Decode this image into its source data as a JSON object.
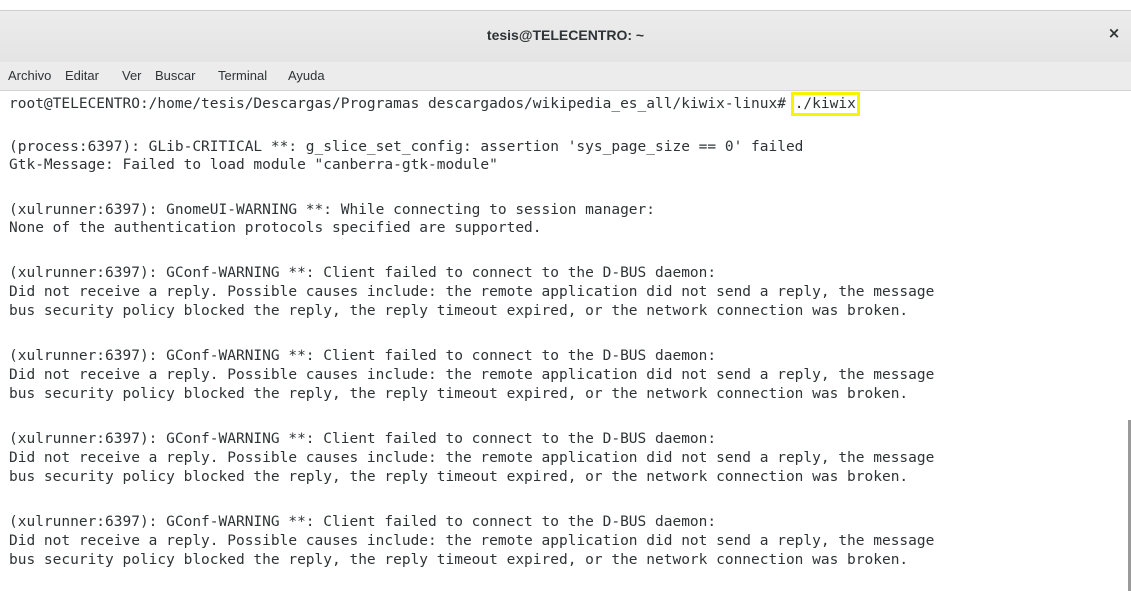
{
  "window": {
    "title": "tesis@TELECENTRO: ~",
    "close_glyph": "×"
  },
  "menu": {
    "items": [
      "Archivo",
      "Editar",
      "Ver",
      "Buscar",
      "Terminal",
      "Ayuda"
    ]
  },
  "terminal": {
    "prompt": "root@TELECENTRO:/home/tesis/Descargas/Programas descargados/wikipedia_es_all/kiwix-linux# ",
    "command": "./kiwix",
    "highlight_color": "#f5f500",
    "output": [
      "(process:6397): GLib-CRITICAL **: g_slice_set_config: assertion 'sys_page_size == 0' failed",
      "Gtk-Message: Failed to load module \"canberra-gtk-module\"",
      "(xulrunner:6397): GnomeUI-WARNING **: While connecting to session manager:",
      "None of the authentication protocols specified are supported.",
      "(xulrunner:6397): GConf-WARNING **: Client failed to connect to the D-BUS daemon:",
      "Did not receive a reply. Possible causes include: the remote application did not send a reply, the message",
      "bus security policy blocked the reply, the reply timeout expired, or the network connection was broken.",
      "(xulrunner:6397): GConf-WARNING **: Client failed to connect to the D-BUS daemon:",
      "Did not receive a reply. Possible causes include: the remote application did not send a reply, the message",
      "bus security policy blocked the reply, the reply timeout expired, or the network connection was broken.",
      "(xulrunner:6397): GConf-WARNING **: Client failed to connect to the D-BUS daemon:",
      "Did not receive a reply. Possible causes include: the remote application did not send a reply, the message",
      "bus security policy blocked the reply, the reply timeout expired, or the network connection was broken.",
      "(xulrunner:6397): GConf-WARNING **: Client failed to connect to the D-BUS daemon:",
      "Did not receive a reply. Possible causes include: the remote application did not send a reply, the message",
      "bus security policy blocked the reply, the reply timeout expired, or the network connection was broken."
    ]
  }
}
